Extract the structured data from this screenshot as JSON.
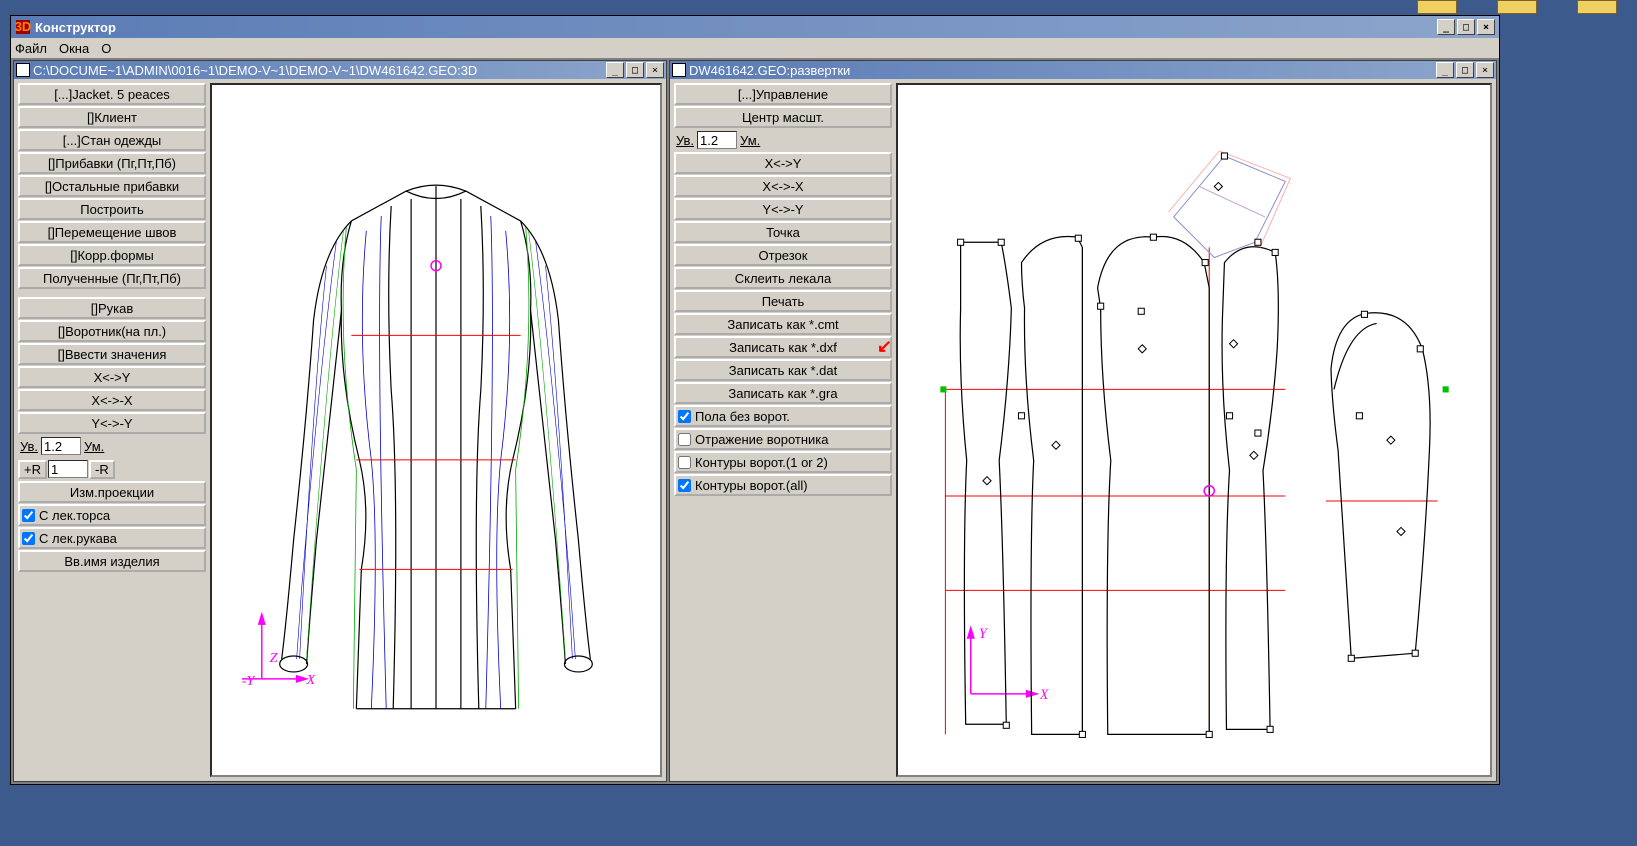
{
  "app": {
    "title": "Конструктор",
    "menu": {
      "file": "Файл",
      "windows": "Окна",
      "about": "О"
    }
  },
  "left_window": {
    "title": "C:\\DOCUME~1\\ADMIN\\0016~1\\DEMO-V~1\\DEMO-V~1\\DW461642.GEO:3D",
    "panel": {
      "jacket": "[...]Jacket. 5 peaces",
      "client": "[]Клиент",
      "stan": "[...]Стан одежды",
      "pribavki": "[]Прибавки (Пг,Пт,Пб)",
      "ostalnye": "[]Остальные прибавки",
      "postroit": "Построить",
      "peremesh": "[]Перемещение швов",
      "korr": "[]Корр.формы",
      "poluch": "Полученные (Пг,Пт,Пб)",
      "rukav": "[]Рукав",
      "vorotnik": "[]Воротник(на пл.)",
      "vvesti": "[]Ввести значения",
      "xy": "X<->Y",
      "xx": "X<->-X",
      "yy": "Y<->-Y",
      "uv": "Ув.",
      "um": "Ум.",
      "uv_val": "1.2",
      "plusR": "+R",
      "minusR": "-R",
      "r_val": "1",
      "izm": "Изм.проекции",
      "slek_torsa": "С лек.торса",
      "slek_rukava": "С лек.рукава",
      "vvima": "Вв.имя изделия"
    }
  },
  "right_window": {
    "title": "DW461642.GEO:развертки",
    "panel": {
      "upr": "[...]Управление",
      "centr": "Центр масшт.",
      "uv": "Ув.",
      "um": "Ум.",
      "uv_val": "1.2",
      "xy": "X<->Y",
      "xx": "X<->-X",
      "yy": "Y<->-Y",
      "tochka": "Точка",
      "otrezok": "Отрезок",
      "skleit": "Склеить лекала",
      "pechat": "Печать",
      "zap_cmt": "Записать как *.cmt",
      "zap_dxf": "Записать как *.dxf",
      "zap_dat": "Записать как *.dat",
      "zap_gra": "Записать как *.gra",
      "pola": "Пола без ворот.",
      "otrazh": "Отражение воротника",
      "kontury12": "Контуры ворот.(1 or 2)",
      "kontury_all": "Контуры ворот.(all)"
    }
  }
}
